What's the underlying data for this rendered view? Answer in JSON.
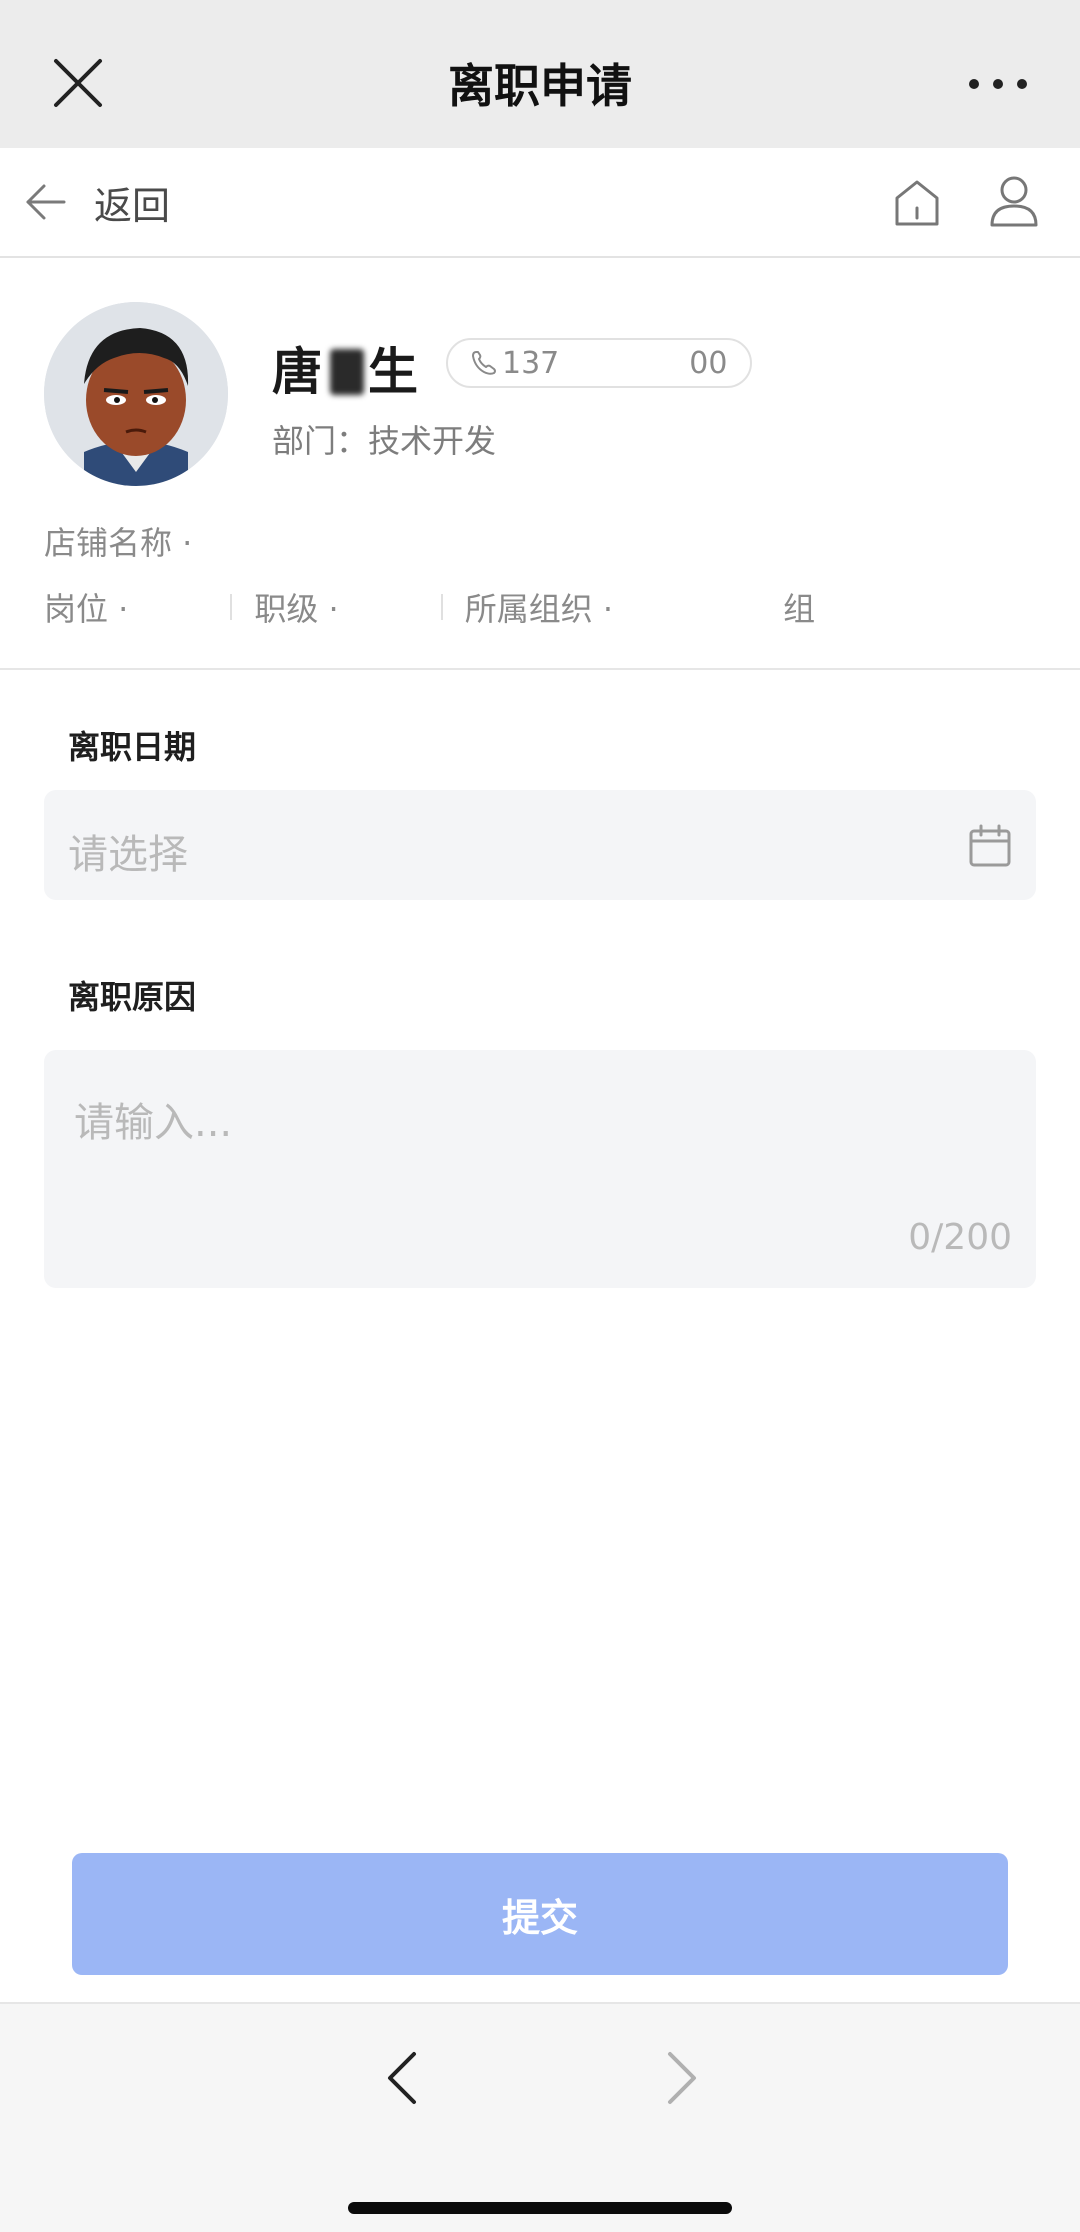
{
  "titlebar": {
    "title": "离职申请",
    "close_icon": "close-icon",
    "more_icon": "more-icon"
  },
  "nav": {
    "back_label": "返回",
    "home_icon": "home-icon",
    "user_icon": "user-icon"
  },
  "profile": {
    "name_prefix": "唐",
    "name_suffix": "生",
    "phone_start": "137",
    "phone_end": "00",
    "dept": "部门：技术开发",
    "store_label": "店铺名称 ·",
    "post_label": "岗位 ·",
    "level_label": "职级 ·",
    "org_label": "所属组织 ·",
    "org_suffix": "组"
  },
  "form": {
    "date_label": "离职日期",
    "date_placeholder": "请选择",
    "reason_label": "离职原因",
    "reason_placeholder": "请输入...",
    "reason_counter": "0/200"
  },
  "submit_label": "提交",
  "colors": {
    "titlebar_bg": "#ececec",
    "submit_bg": "#9bb6f5",
    "field_bg": "#f4f5f7"
  }
}
